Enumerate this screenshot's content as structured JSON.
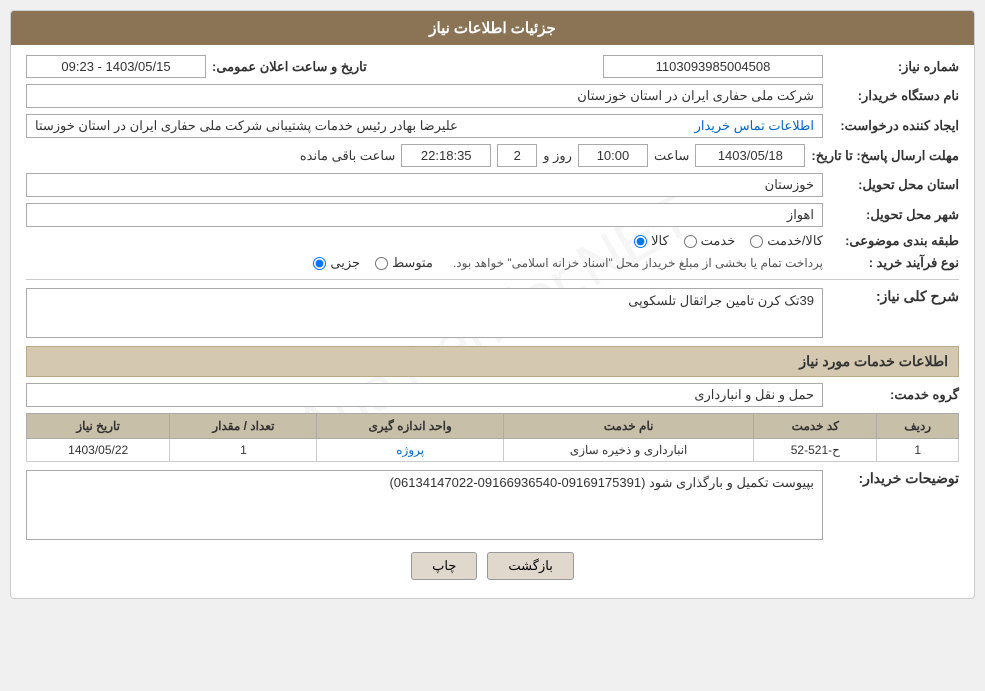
{
  "header": {
    "title": "جزئیات اطلاعات نیاز"
  },
  "fields": {
    "need_number_label": "شماره نیاز:",
    "need_number_value": "1103093985004508",
    "announcement_date_label": "تاریخ و ساعت اعلان عمومی:",
    "announcement_date_value": "1403/05/15 - 09:23",
    "buyer_org_label": "نام دستگاه خریدار:",
    "buyer_org_value": "شرکت ملی حفاری ایران در استان خوزستان",
    "creator_label": "ایجاد کننده درخواست:",
    "creator_value": "علیرضا بهادر رئیس خدمات پشتیبانی شرکت ملی حفاری ایران در استان خوزستا",
    "creator_link": "اطلاعات تماس خریدار",
    "deadline_label": "مهلت ارسال پاسخ: تا تاریخ:",
    "deadline_date": "1403/05/18",
    "deadline_time_label": "ساعت",
    "deadline_time": "10:00",
    "deadline_days_label": "روز و",
    "deadline_days": "2",
    "deadline_remaining_label": "ساعت باقی مانده",
    "deadline_remaining": "22:18:35",
    "delivery_province_label": "استان محل تحویل:",
    "delivery_province_value": "خوزستان",
    "delivery_city_label": "شهر محل تحویل:",
    "delivery_city_value": "اهواز",
    "category_label": "طبقه بندی موضوعی:",
    "category_kala": "کالا",
    "category_khadamat": "خدمت",
    "category_kala_khadamat": "کالا/خدمت",
    "purchase_type_label": "نوع فرآیند خرید :",
    "purchase_type_jazzi": "جزیی",
    "purchase_type_motevaset": "متوسط",
    "purchase_type_note": "پرداخت تمام یا بخشی از مبلغ خریداز محل \"اسناد خزانه اسلامی\" خواهد بود.",
    "need_desc_label": "شرح کلی نیاز:",
    "need_desc_value": "39تک کرن تامین جراثقال تلسکوپی",
    "services_section_label": "اطلاعات خدمات مورد نیاز",
    "service_group_label": "گروه خدمت:",
    "service_group_value": "حمل و نقل و انبارداری",
    "table": {
      "col_radif": "ردیف",
      "col_code": "کد خدمت",
      "col_name": "نام خدمت",
      "col_unit": "واحد اندازه گیری",
      "col_count": "تعداد / مقدار",
      "col_date": "تاریخ نیاز",
      "rows": [
        {
          "radif": "1",
          "code": "ح-521-52",
          "name": "انبارداری و ذخیره سازی",
          "unit": "پروژه",
          "count": "1",
          "date": "1403/05/22"
        }
      ]
    },
    "buyer_notes_label": "توضیحات خریدار:",
    "buyer_notes_value": "بپیوست تکمیل و بارگذاری شود (09169175391-09166936540-06134147022)"
  },
  "buttons": {
    "print": "چاپ",
    "back": "بازگشت"
  }
}
